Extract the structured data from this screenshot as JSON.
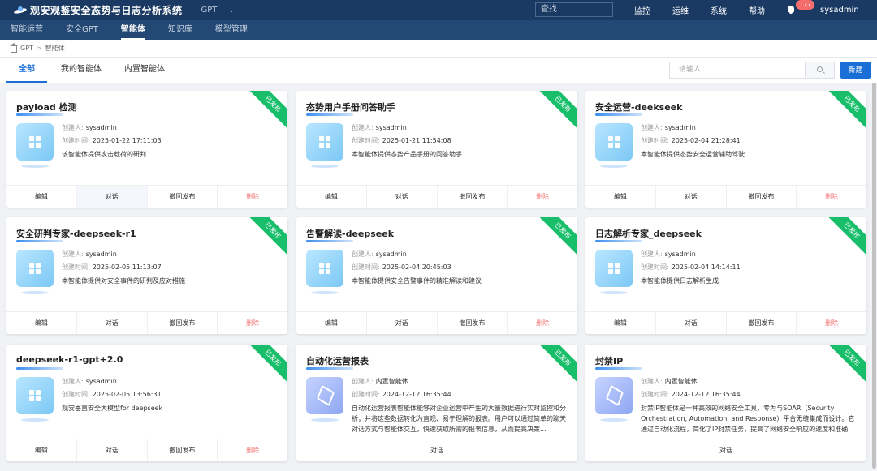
{
  "header": {
    "app_title": "观安观鉴安全态势与日志分析系统",
    "module_select": "GPT",
    "search_placeholder": "查找",
    "nav": [
      "监控",
      "运维",
      "系统",
      "帮助"
    ],
    "notification_count": "177",
    "username": "sysadmin"
  },
  "subnav": {
    "items": [
      "智能运营",
      "安全GPT",
      "智能体",
      "知识库",
      "模型管理"
    ],
    "active": "智能体"
  },
  "breadcrumb": [
    "GPT",
    "智能体"
  ],
  "tabs": {
    "items": [
      "全部",
      "我的智能体",
      "内置智能体"
    ],
    "active": "全部"
  },
  "search": {
    "placeholder": "请输入"
  },
  "new_button": "新建",
  "labels": {
    "creator": "创建人:",
    "created_time": "创建时间:",
    "published": "已发布"
  },
  "actions": {
    "edit": "编辑",
    "chat": "对话",
    "unpublish": "撤回发布",
    "delete": "删除"
  },
  "cards": [
    {
      "title": "payload 检测",
      "creator": "sysadmin",
      "time": "2025-01-22 17:11:03",
      "desc": "该智能体提供攻击载荷的研判",
      "builtin": false
    },
    {
      "title": "态势用户手册问答助手",
      "creator": "sysadmin",
      "time": "2025-01-21 11:54:08",
      "desc": "本智能体提供态势产品手册的问答助手",
      "builtin": false
    },
    {
      "title": "安全运营-deekseek",
      "creator": "sysadmin",
      "time": "2025-02-04 21:28:41",
      "desc": "本智能体提供态势安全运营辅助驾驶",
      "builtin": false
    },
    {
      "title": "安全研判专家-deepseek-r1",
      "creator": "sysadmin",
      "time": "2025-02-05 11:13:07",
      "desc": "本智能体提供对安全事件的研判及应对措施",
      "builtin": false
    },
    {
      "title": "告警解读-deepseek",
      "creator": "sysadmin",
      "time": "2025-02-04 20:45:03",
      "desc": "本智能体提供安全告警事件的精准解读和建议",
      "builtin": false
    },
    {
      "title": "日志解析专家_deepseek",
      "creator": "sysadmin",
      "time": "2025-02-04 14:14:11",
      "desc": "本智能体提供日志解析生成",
      "builtin": false
    },
    {
      "title": "deepseek-r1-gpt+2.0",
      "creator": "sysadmin",
      "time": "2025-02-05 13:56:31",
      "desc": "观安垂直安全大模型for deepseek",
      "builtin": false
    },
    {
      "title": "自动化运营报表",
      "creator": "内置智能体",
      "time": "2024-12-12 16:35:44",
      "desc": "自动化运营报表智能体能够对企业运营中产生的大量数据进行实时监控和分析，并将这些数据转化为直观、易于理解的报表。用户可以通过简单的聊天对话方式与智能体交互，快速获取所需的报表信息，从而提高决策...",
      "builtin": true
    },
    {
      "title": "封禁IP",
      "creator": "内置智能体",
      "time": "2024-12-12 16:35:44",
      "desc": "封禁IP智能体是一种高效的网络安全工具，专为与SOAR（Security Orchestration, Automation, and Response）平台无缝集成而设计。它通过自动化流程，简化了IP封禁任务，提高了网络安全响应的速度和准确性。...",
      "builtin": true
    }
  ]
}
